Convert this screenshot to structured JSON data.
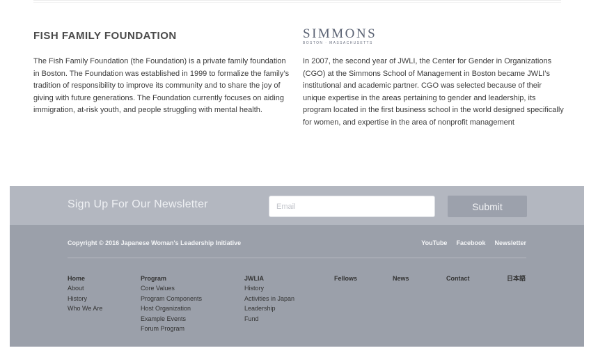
{
  "fish": {
    "title": "FISH FAMILY FOUNDATION",
    "body": "The Fish Family Foundation (the Foundation) is a private family foundation in Boston. The Foundation was established in 1999 to formalize the family’s tradition of responsibility to improve its community and to share the joy of giving with future generations. The Foundation currently focuses on aiding immigration, at-risk youth, and people struggling with mental health."
  },
  "simmons": {
    "logo_name": "SIMMONS",
    "logo_sub": "BOSTON · MASSACHUSETTS",
    "body": "In 2007, the second year of JWLI, the Center for Gender in Organizations (CGO) at the Simmons School of  Management in Boston became JWLI’s institutional and academic partner. CGO was selected because of their unique expertise in the areas pertaining to gender and leadership, its program located in the first business school in the world designed specifically for women, and expertise in the area of nonprofit management"
  },
  "newsletter": {
    "title": "Sign Up For Our Newsletter",
    "email_placeholder": "Email",
    "submit_label": "Submit"
  },
  "footer": {
    "copyright": "Copyright © 2016 Japanese Woman's Leadership Initiative",
    "social": [
      "YouTube",
      "Facebook",
      "Newsletter"
    ],
    "columns": [
      {
        "heading": "Home",
        "links": [
          "About",
          "History",
          "Who We Are"
        ]
      },
      {
        "heading": "Program",
        "links": [
          "Core Values",
          "Program Components",
          "Host Organization",
          "Example Events",
          "Forum Program"
        ]
      },
      {
        "heading": "JWLIA",
        "links": [
          "History",
          "Activities in Japan",
          "Leadership",
          "Fund"
        ]
      },
      {
        "heading": "Fellows",
        "links": []
      },
      {
        "heading": "News",
        "links": []
      },
      {
        "heading": "Contact",
        "links": []
      },
      {
        "heading": "日本語",
        "links": []
      }
    ]
  }
}
